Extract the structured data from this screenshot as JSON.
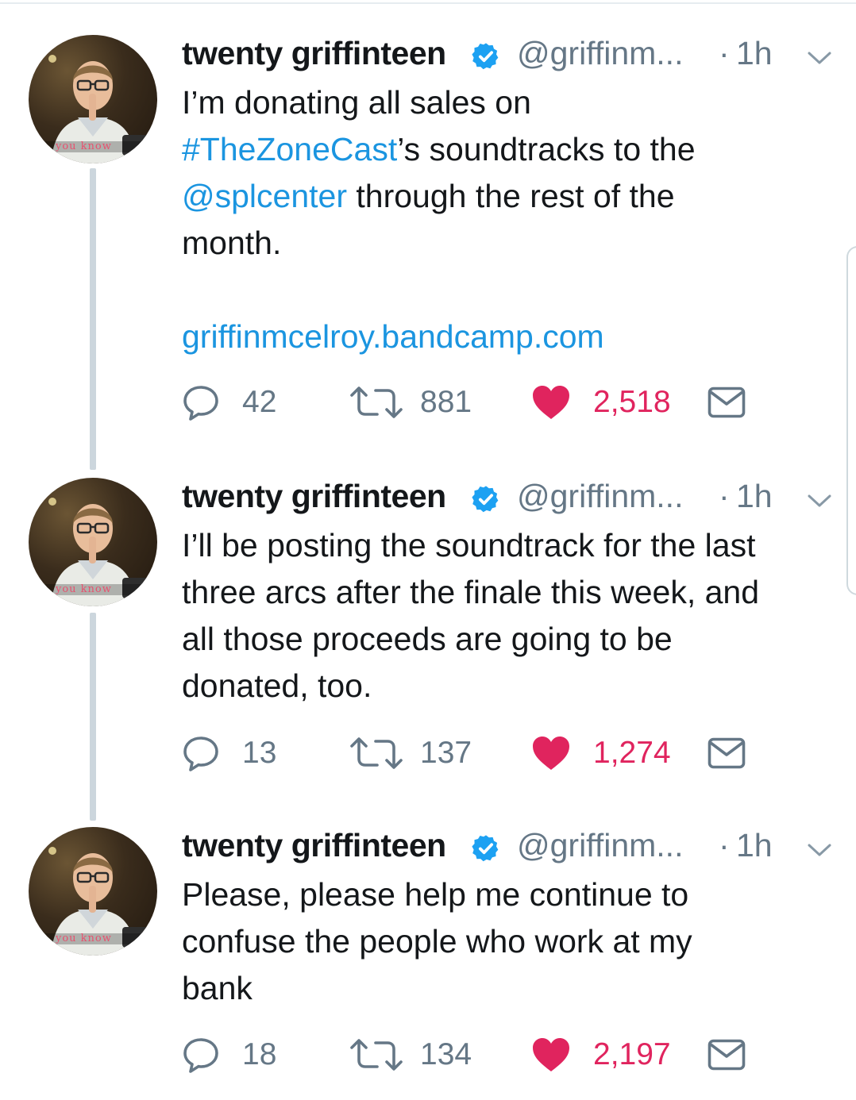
{
  "author": {
    "name": "twenty griffinteen",
    "handle": "@griffinm...",
    "separator": "·",
    "avatar_caption": "you know"
  },
  "tweets": [
    {
      "time": "1h",
      "lines": [
        [
          {
            "t": "I’m donating all sales on"
          }
        ],
        [
          {
            "t": "#TheZoneCast",
            "link": true
          },
          {
            "t": "’s soundtracks to the"
          }
        ],
        [
          {
            "t": "@splcenter",
            "link": true
          },
          {
            "t": " through the rest of the"
          }
        ],
        [
          {
            "t": "month."
          }
        ],
        [],
        [
          {
            "t": "griffinmcelroy.bandcamp.com",
            "link": true
          }
        ]
      ],
      "replies": "42",
      "retweets": "881",
      "likes": "2,518"
    },
    {
      "time": "1h",
      "lines": [
        [
          {
            "t": "I’ll be posting the soundtrack for the last"
          }
        ],
        [
          {
            "t": "three arcs after the finale this week, and"
          }
        ],
        [
          {
            "t": "all those proceeds are going to be"
          }
        ],
        [
          {
            "t": "donated, too."
          }
        ]
      ],
      "replies": "13",
      "retweets": "137",
      "likes": "1,274"
    },
    {
      "time": "1h",
      "lines": [
        [
          {
            "t": "Please, please help me continue to"
          }
        ],
        [
          {
            "t": "confuse the people who work at my"
          }
        ],
        [
          {
            "t": "bank"
          }
        ]
      ],
      "replies": "18",
      "retweets": "134",
      "likes": "2,197"
    }
  ],
  "colors": {
    "link": "#1b95e0",
    "like": "#e0245e",
    "verified": "#1da1f2",
    "muted": "#657786",
    "thread_line": "#ccd6dd"
  },
  "icons": [
    "verified-badge-icon",
    "chevron-down-icon",
    "reply-icon",
    "retweet-icon",
    "heart-icon",
    "direct-message-icon"
  ]
}
